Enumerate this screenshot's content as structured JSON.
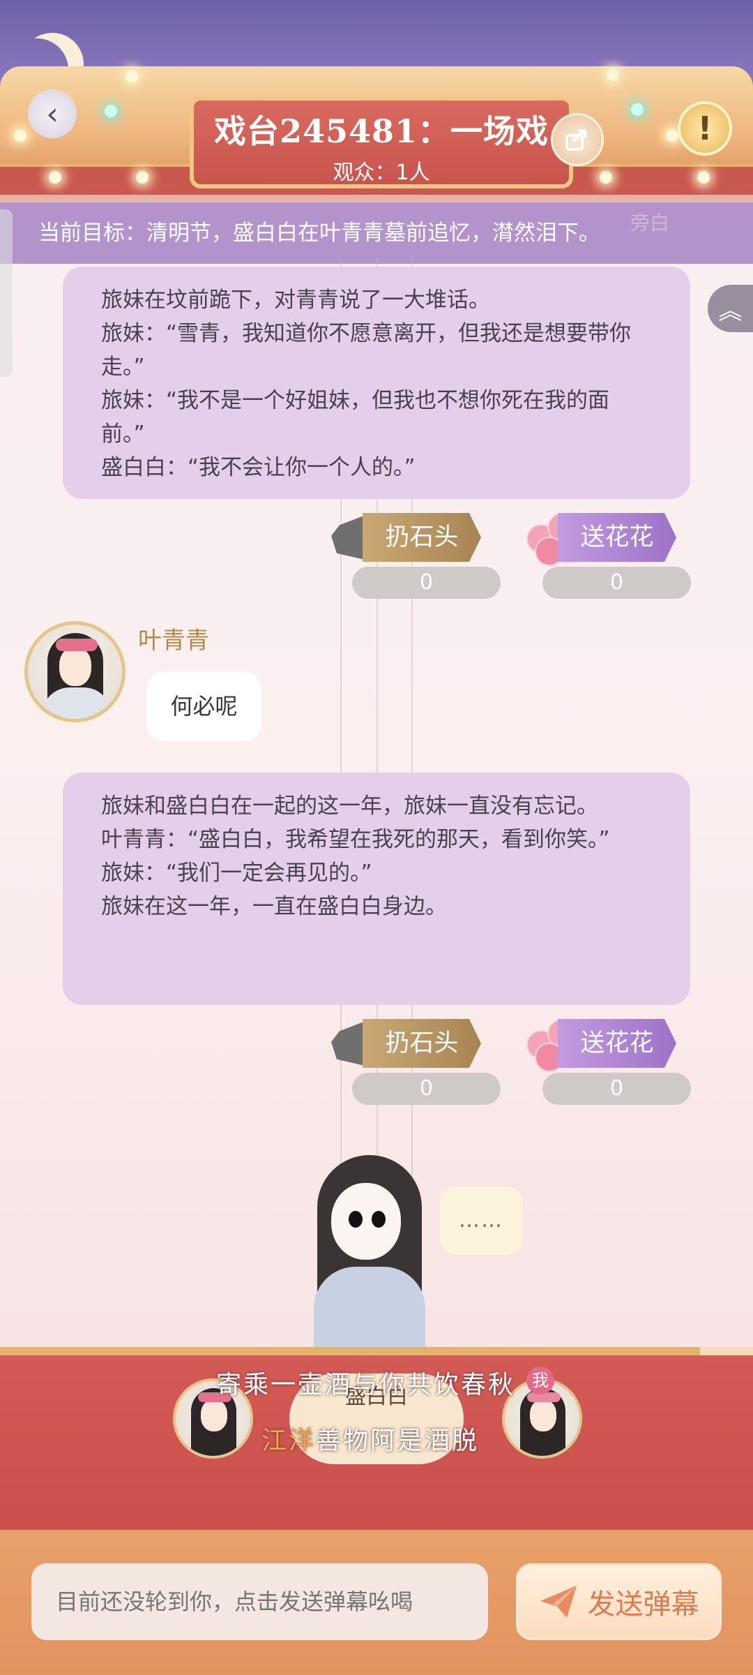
{
  "header": {
    "title": "戏台245481：一场戏",
    "audience": "观众：1人"
  },
  "objective": {
    "text": "当前目标：清明节，盛白白在叶青青墓前追忆，潸然泪下。",
    "ghost_text": "旁白"
  },
  "narrations": [
    {
      "lines": [
        "旅妹在坟前跪下，对青青说了一大堆话。",
        "旅妹：“雪青，我知道你不愿意离开，但我还是想要带你走。”",
        "旅妹：“我不是一个好姐妹，但我也不想你死在我的面前。”",
        "盛白白：“我不会让你一个人的。”"
      ],
      "stone_label": "扔石头",
      "stone_count": "0",
      "flower_label": "送花花",
      "flower_count": "0"
    },
    {
      "lines": [
        "旅妹和盛白白在一起的这一年，旅妹一直没有忘记。",
        "叶青青：“盛白白，我希望在我死的那天，看到你笑。”",
        "旅妹：“我们一定会再见的。”",
        "旅妹在这一年，一直在盛白白身边。"
      ],
      "stone_label": "扔石头",
      "stone_count": "0",
      "flower_label": "送花花",
      "flower_count": "0"
    }
  ],
  "chat": {
    "speaker": "叶青青",
    "message": "何必呢"
  },
  "stage": {
    "thought": "……",
    "progress": 0.93,
    "current_player": "盛白白",
    "me_badge": "我",
    "poem_line1": "寄乘一壶酒与你共饮春秋",
    "poem_line2_hl": "江洋",
    "poem_line2": "善物阿是酒脱"
  },
  "footer": {
    "input_placeholder": "目前还没轮到你，点击发送弹幕吆喝",
    "send_label": "发送弹幕"
  },
  "colors": {
    "accent": "#c9544d",
    "narration_bg": "#e3cfe9",
    "stone": "#a88453",
    "flower": "#9d72c9"
  }
}
